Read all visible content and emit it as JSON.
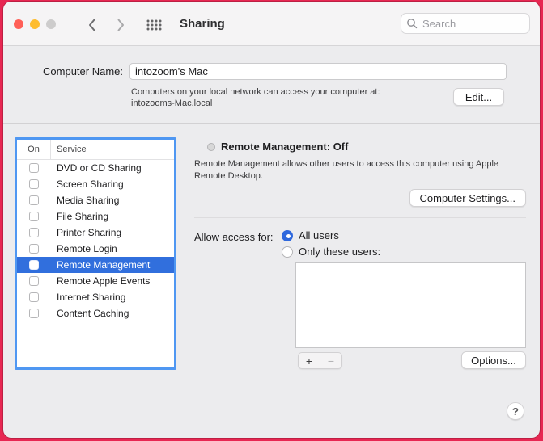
{
  "colors": {
    "desktop": "#e72752",
    "accent": "#2e68dd",
    "selection": "#316fdd",
    "focus_ring": "#4f97f2"
  },
  "toolbar": {
    "title": "Sharing",
    "search_placeholder": "Search"
  },
  "computer_name": {
    "label": "Computer Name:",
    "value": "intozoom's Mac",
    "description_line1": "Computers on your local network can access your computer at:",
    "description_line2": "intozooms-Mac.local",
    "edit_button": "Edit..."
  },
  "services": {
    "columns": {
      "on": "On",
      "service": "Service"
    },
    "items": [
      {
        "label": "DVD or CD Sharing",
        "checked": false,
        "selected": false
      },
      {
        "label": "Screen Sharing",
        "checked": false,
        "selected": false
      },
      {
        "label": "Media Sharing",
        "checked": false,
        "selected": false
      },
      {
        "label": "File Sharing",
        "checked": false,
        "selected": false
      },
      {
        "label": "Printer Sharing",
        "checked": false,
        "selected": false
      },
      {
        "label": "Remote Login",
        "checked": false,
        "selected": false
      },
      {
        "label": "Remote Management",
        "checked": false,
        "selected": true
      },
      {
        "label": "Remote Apple Events",
        "checked": false,
        "selected": false
      },
      {
        "label": "Internet Sharing",
        "checked": false,
        "selected": false
      },
      {
        "label": "Content Caching",
        "checked": false,
        "selected": false
      }
    ]
  },
  "detail": {
    "status_label": "Remote Management: Off",
    "description": "Remote Management allows other users to access this computer using Apple Remote Desktop.",
    "computer_settings_button": "Computer Settings...",
    "allow_access_label": "Allow access for:",
    "all_users_label": "All users",
    "all_users_selected": true,
    "only_these_users_label": "Only these users:",
    "only_these_users_selected": false,
    "add_button": "+",
    "remove_button": "−",
    "options_button": "Options..."
  },
  "help_button": "?"
}
